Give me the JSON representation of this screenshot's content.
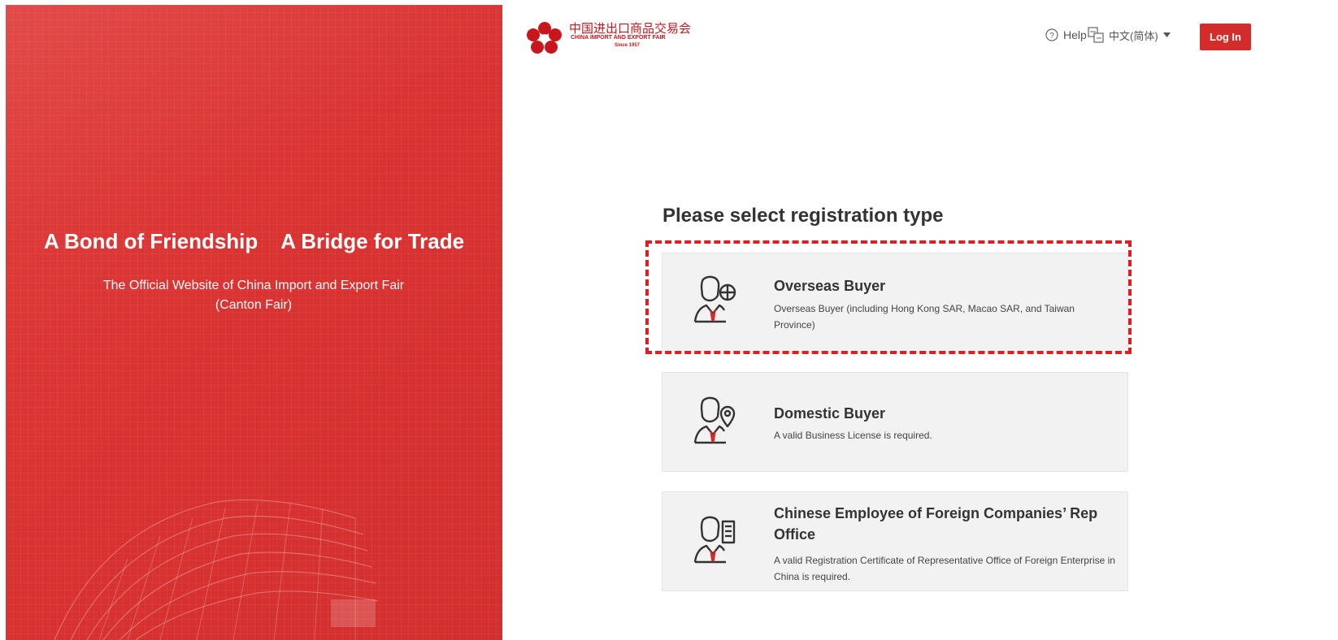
{
  "hero": {
    "title": "A Bond of Friendship    A Bridge for Trade",
    "subtitle": "The Official Website of China Import and Export Fair (Canton Fair)"
  },
  "header": {
    "logo_cn": "中国进出口商品交易会",
    "logo_en": "CHINA IMPORT AND EXPORT FAIR",
    "logo_since": "Since 1957",
    "help_label": "Help",
    "language_label": "中文(简体)",
    "login_label": "Log In"
  },
  "main": {
    "title": "Please select registration type",
    "options": [
      {
        "title": "Overseas Buyer",
        "description": "Overseas Buyer (including Hong Kong SAR, Macao SAR, and Taiwan Province)",
        "icon": "globe-person-icon"
      },
      {
        "title": "Domestic Buyer",
        "description": "A valid Business License is required.",
        "icon": "location-person-icon"
      },
      {
        "title": "Chinese Employee of Foreign Companies’ Rep Office",
        "description": "A valid Registration Certificate of Representative Office of Foreign Enterprise in China is required.",
        "icon": "document-person-icon"
      }
    ]
  },
  "colors": {
    "brand_red": "#d42b2b",
    "hero_red": "#d93332",
    "card_bg": "#f2f2f2",
    "highlight": "#e01e1e"
  }
}
